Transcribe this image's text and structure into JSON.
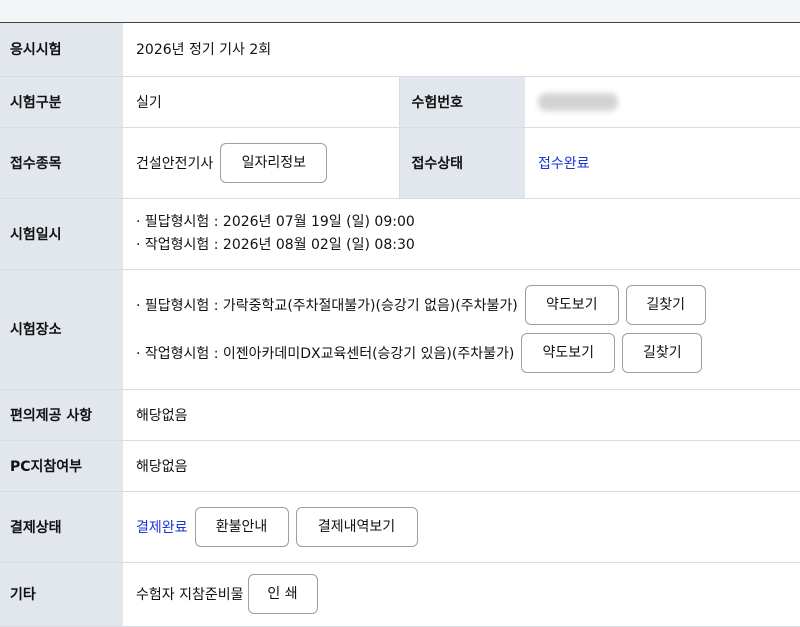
{
  "rows": {
    "exam": {
      "label": "응시시험",
      "value": "2026년 정기 기사 2회"
    },
    "category": {
      "label": "시험구분",
      "value": "실기",
      "number_label": "수험번호",
      "number_value": ""
    },
    "subject": {
      "label": "접수종목",
      "value": "건설안전기사",
      "job_button": "일자리정보",
      "status_label": "접수상태",
      "status_value": "접수완료"
    },
    "date": {
      "label": "시험일시",
      "written": "· 필답형시험 : 2026년 07월 19일 (일) 09:00",
      "practical": "· 작업형시험 : 2026년 08월 02일 (일) 08:30"
    },
    "place": {
      "label": "시험장소",
      "written": "· 필답형시험 : 가락중학교(주차절대불가)(승강기 없음)(주차불가)",
      "practical": "· 작업형시험 : 이젠아카데미DX교육센터(승강기 있음)(주차불가)",
      "map_button": "약도보기",
      "route_button": "길찾기"
    },
    "convenience": {
      "label": "편의제공 사항",
      "value": "해당없음"
    },
    "pc": {
      "label": "PC지참여부",
      "value": "해당없음"
    },
    "payment": {
      "label": "결제상태",
      "value": "결제완료",
      "refund_button": "환불안내",
      "history_button": "결제내역보기"
    },
    "etc": {
      "label": "기타",
      "value": "수험자 지참준비물",
      "print_button": "인 쇄"
    }
  },
  "colors": {
    "header_bg": "#e2e6ed",
    "link_blue": "#1a35d6",
    "border": "#d9dce1"
  }
}
